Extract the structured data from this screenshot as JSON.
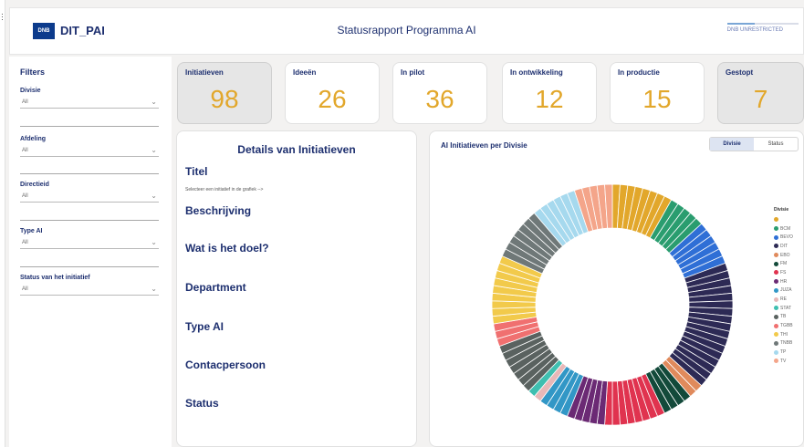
{
  "header": {
    "logo_text": "DNB",
    "brand": "DIT_PAI",
    "title": "Statusrapport Programma AI",
    "classification": "DNB UNRESTRICTED"
  },
  "filters": {
    "heading": "Filters",
    "groups": [
      {
        "label": "Divisie",
        "value": "All"
      },
      {
        "label": "Afdeling",
        "value": "All"
      },
      {
        "label": "Directieid",
        "value": "All"
      },
      {
        "label": "Type AI",
        "value": "All"
      },
      {
        "label": "Status van het initiatief",
        "value": "All"
      }
    ]
  },
  "cards": [
    {
      "label": "Initiatieven",
      "value": "98"
    },
    {
      "label": "Ideeën",
      "value": "26"
    },
    {
      "label": "In pilot",
      "value": "36"
    },
    {
      "label": "In ontwikkeling",
      "value": "12"
    },
    {
      "label": "In productie",
      "value": "15"
    },
    {
      "label": "Gestopt",
      "value": "7"
    }
  ],
  "details": {
    "heading": "Details van Initiatieven",
    "hint": "Selecteer een initiatief in de grafiek -->",
    "fields": [
      "Titel",
      "Beschrijving",
      "Wat is het doel?",
      "Department",
      "Type AI",
      "Contacpersoon",
      "Status"
    ]
  },
  "chart_panel": {
    "title": "AI Initiatieven per Divisie",
    "toggle": [
      "Divisie",
      "Status"
    ],
    "legend_title": "Divisie"
  },
  "chart_data": {
    "type": "pie",
    "legend_title": "Divisie",
    "segments": [
      {
        "name": "",
        "value": 8,
        "color": "#e2a72b"
      },
      {
        "name": "BCM",
        "value": 5,
        "color": "#2a9d6f"
      },
      {
        "name": "BEVO",
        "value": 6,
        "color": "#2f6fd6"
      },
      {
        "name": "DIT",
        "value": 17,
        "color": "#2d2a55"
      },
      {
        "name": "EBO",
        "value": 2,
        "color": "#e08a5c"
      },
      {
        "name": "FM",
        "value": 4,
        "color": "#134a3a"
      },
      {
        "name": "FS",
        "value": 8,
        "color": "#e0334f"
      },
      {
        "name": "HR",
        "value": 5,
        "color": "#6b2a74"
      },
      {
        "name": "JUZA",
        "value": 4,
        "color": "#3297c6"
      },
      {
        "name": "RE",
        "value": 1,
        "color": "#e8b8b8"
      },
      {
        "name": "STAT",
        "value": 1,
        "color": "#3fbfb0"
      },
      {
        "name": "TB",
        "value": 7,
        "color": "#5a6260"
      },
      {
        "name": "TGBB",
        "value": 3,
        "color": "#f07070"
      },
      {
        "name": "THI",
        "value": 9,
        "color": "#f2ca4b"
      },
      {
        "name": "TNBB",
        "value": 7,
        "color": "#6f7878"
      },
      {
        "name": "TP",
        "value": 6,
        "color": "#a6d9ee"
      },
      {
        "name": "TV",
        "value": 5,
        "color": "#f4a58a"
      }
    ]
  }
}
